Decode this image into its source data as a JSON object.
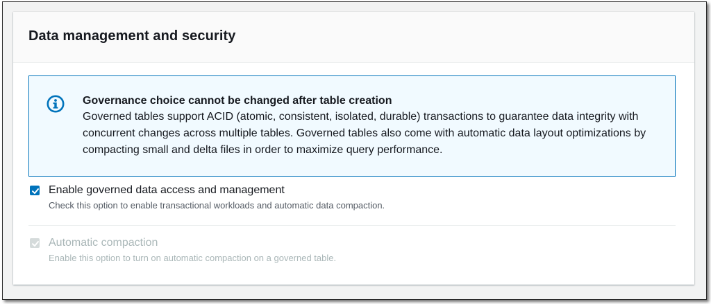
{
  "panel": {
    "title": "Data management and security"
  },
  "alert": {
    "icon": "info-icon",
    "title": "Governance choice cannot be changed after table creation",
    "text": "Governed tables support ACID (atomic, consistent, isolated, durable) transactions to guarantee data integrity with concurrent changes across multiple tables. Governed tables also come with automatic data layout optimizations by compacting small and delta files in order to maximize query performance.",
    "border_color": "#0073bb",
    "background_color": "#f1faff"
  },
  "options": [
    {
      "label": "Enable governed data access and management",
      "description": "Check this option to enable transactional workloads and automatic data compaction.",
      "checked": true,
      "disabled": false
    },
    {
      "label": "Automatic compaction",
      "description": "Enable this option to turn on automatic compaction on a governed table.",
      "checked": true,
      "disabled": true
    }
  ],
  "colors": {
    "accent": "#0073bb",
    "text": "#16191f",
    "secondary_text": "#545b64",
    "disabled": "#aab7b8"
  }
}
